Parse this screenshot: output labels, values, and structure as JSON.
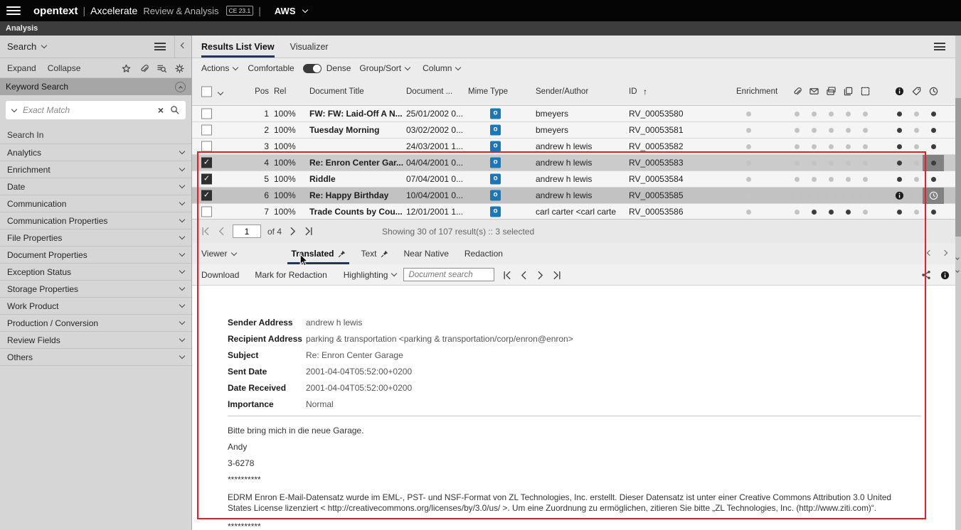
{
  "topbar": {
    "brand": "opentext",
    "pipe": "|",
    "product": "Axcelerate",
    "module": "Review & Analysis",
    "version": "CE 23.1",
    "divider": "|",
    "environment": "AWS"
  },
  "appbar": {
    "tab": "Analysis"
  },
  "sidebar": {
    "panel_title": "Search",
    "expand": "Expand",
    "collapse": "Collapse",
    "section_title": "Keyword Search",
    "search_placeholder": "Exact Match",
    "search_in_label": "Search In",
    "items": [
      "Analytics",
      "Enrichment",
      "Date",
      "Communication",
      "Communication Properties",
      "File Properties",
      "Document Properties",
      "Exception Status",
      "Storage Properties",
      "Work Product",
      "Production / Conversion",
      "Review Fields",
      "Others"
    ]
  },
  "results": {
    "tabs": [
      {
        "label": "Results List View",
        "active": true
      },
      {
        "label": "Visualizer",
        "active": false
      }
    ],
    "toolbar": {
      "actions": "Actions",
      "comfortable": "Comfortable",
      "dense": "Dense",
      "group_sort": "Group/Sort",
      "column": "Column"
    },
    "columns": {
      "pos": "Pos",
      "rel": "Rel",
      "title": "Document Title",
      "date": "Document ...",
      "mime": "Mime Type",
      "sender": "Sender/Author",
      "id": "ID",
      "enrichment": "Enrichment"
    },
    "rows": [
      {
        "pos": "1",
        "rel": "100%",
        "title": "FW: FW: Laid-Off A N...",
        "date": "25/01/2002 0...",
        "mime": "o",
        "sender": "bmeyers",
        "id": "RV_00053580",
        "checked": false,
        "selected": false,
        "focus": false,
        "current": false,
        "indicator_dark": [
          6,
          8
        ]
      },
      {
        "pos": "2",
        "rel": "100%",
        "title": "Tuesday Morning",
        "date": "03/02/2002 0...",
        "mime": "o",
        "sender": "bmeyers",
        "id": "RV_00053581",
        "checked": false,
        "selected": false,
        "focus": false,
        "current": false,
        "indicator_dark": [
          6,
          8
        ]
      },
      {
        "pos": "3",
        "rel": "100%",
        "title": "",
        "date": "24/03/2001 1...",
        "mime": "o",
        "sender": "andrew h lewis",
        "id": "RV_00053582",
        "checked": false,
        "selected": false,
        "focus": false,
        "current": false,
        "indicator_dark": [
          6,
          8
        ]
      },
      {
        "pos": "4",
        "rel": "100%",
        "title": "Re: Enron Center Gar...",
        "date": "04/04/2001 0...",
        "mime": "o",
        "sender": "andrew h lewis",
        "id": "RV_00053583",
        "checked": true,
        "selected": true,
        "focus": true,
        "current": false,
        "indicator_dark": [
          6,
          8
        ]
      },
      {
        "pos": "5",
        "rel": "100%",
        "title": "Riddle",
        "date": "07/04/2001 0...",
        "mime": "o",
        "sender": "andrew h lewis",
        "id": "RV_00053584",
        "checked": true,
        "selected": false,
        "focus": false,
        "current": false,
        "indicator_dark": [
          6,
          8
        ]
      },
      {
        "pos": "6",
        "rel": "100%",
        "title": "Re: Happy Birthday",
        "date": "10/04/2001 0...",
        "mime": "o",
        "sender": "andrew h lewis",
        "id": "RV_00053585",
        "checked": true,
        "selected": true,
        "focus": true,
        "current": true,
        "indicator_dark": []
      },
      {
        "pos": "7",
        "rel": "100%",
        "title": "Trade Counts by Cou...",
        "date": "12/01/2001 1...",
        "mime": "o",
        "sender": "carl carter <carl carte",
        "id": "RV_00053586",
        "checked": false,
        "selected": false,
        "focus": false,
        "current": false,
        "indicator_dark": [
          2,
          3,
          4,
          6,
          8
        ]
      }
    ],
    "pagination": {
      "page_value": "1",
      "of_label": "of 4",
      "status": "Showing 30 of 107 result(s) :: 3 selected"
    }
  },
  "viewer": {
    "panel_title": "Viewer",
    "tabs": [
      {
        "label": "Translated",
        "pinned": true,
        "active": true
      },
      {
        "label": "Text",
        "pinned": true,
        "active": false
      },
      {
        "label": "Near Native",
        "pinned": false,
        "active": false
      },
      {
        "label": "Redaction",
        "pinned": false,
        "active": false
      }
    ],
    "toolbar": {
      "download": "Download",
      "mark_for_redaction": "Mark for Redaction",
      "highlighting": "Highlighting",
      "doc_search_placeholder": "Document search"
    },
    "doc": {
      "fields": [
        {
          "label": "Sender Address",
          "value": "andrew h lewis"
        },
        {
          "label": "Recipient Address",
          "value": "parking & transportation <parking & transportation/corp/enron@enron>"
        },
        {
          "label": "Subject",
          "value": "Re: Enron Center Garage"
        },
        {
          "label": "Sent Date",
          "value": "2001-04-04T05:52:00+0200"
        },
        {
          "label": "Date Received",
          "value": "2001-04-04T05:52:00+0200"
        },
        {
          "label": "Importance",
          "value": "Normal"
        }
      ],
      "body": [
        "Bitte bring mich in die neue Garage.",
        "Andy",
        "3-6278",
        "**********",
        "EDRM Enron E-Mail-Datensatz wurde im EML-, PST- und NSF-Format von ZL Technologies, Inc. erstellt. Dieser Datensatz ist unter einer Creative Commons Attribution 3.0 United States License lizenziert < http://creativecommons.org/licenses/by/3.0/us/ >. Um eine Zuordnung zu ermöglichen, zitieren Sie bitte „ZL Technologies, Inc. (http://www.ziti.com)“.",
        "**********"
      ]
    }
  },
  "colors": {
    "accent_underline": "#21365c",
    "mime_icon": "#1878b8",
    "annotation_red": "#ee1c25"
  }
}
